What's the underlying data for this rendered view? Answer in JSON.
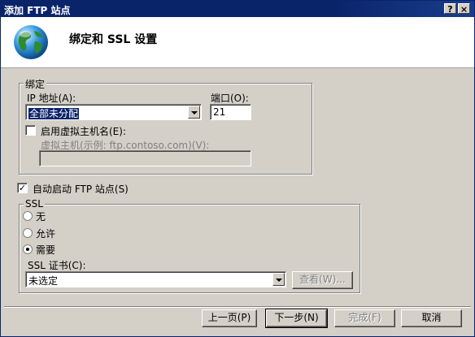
{
  "window": {
    "title": "添加 FTP 站点",
    "help_label": "?",
    "close_label": "×"
  },
  "header": {
    "title": "绑定和 SSL 设置",
    "icon": "globe-icon"
  },
  "binding": {
    "group_label": "绑定",
    "ip_label": "IP 地址(A):",
    "ip_value": "全部未分配",
    "port_label": "端口(O):",
    "port_value": "21",
    "virtual_host_checkbox_label": "启用虚拟主机名(E):",
    "virtual_host_checked": false,
    "virtual_host_label": "虚拟主机(示例: ftp.contoso.com)(V):",
    "virtual_host_value": ""
  },
  "autostart": {
    "label": "自动启动 FTP 站点(S)",
    "checked": true,
    "check_mark": "✓"
  },
  "ssl": {
    "group_label": "SSL",
    "options": [
      {
        "label": "无",
        "selected": false
      },
      {
        "label": "允许",
        "selected": false
      },
      {
        "label": "需要",
        "selected": true
      }
    ],
    "cert_label": "SSL 证书(C):",
    "cert_value": "未选定",
    "view_button": "查看(W)..."
  },
  "footer": {
    "prev": "上一页(P)",
    "next": "下一步(N)",
    "finish": "完成(F)",
    "cancel": "取消"
  }
}
